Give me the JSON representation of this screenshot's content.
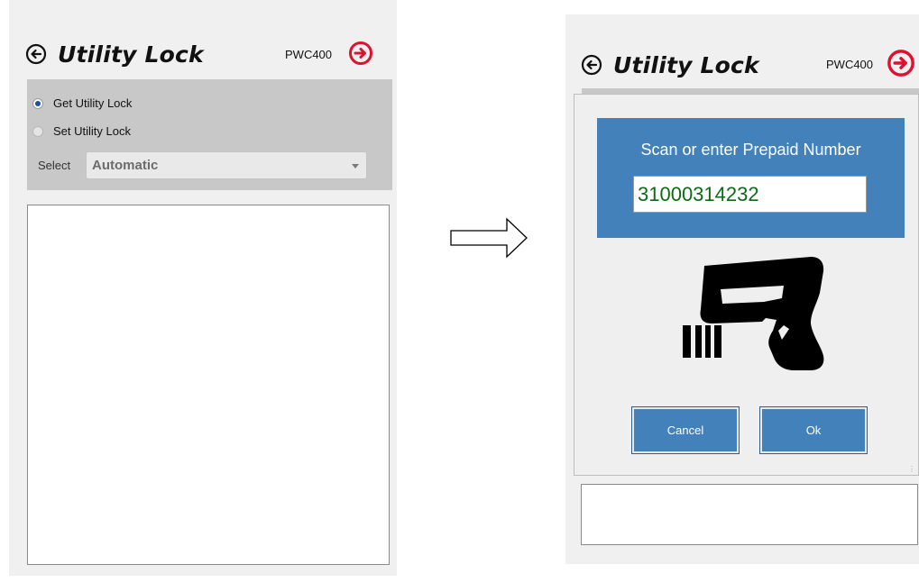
{
  "left_window": {
    "title": "Utility Lock",
    "model": "PWC400",
    "options": [
      {
        "label": "Get Utility Lock",
        "selected": true
      },
      {
        "label": "Set Utility Lock",
        "selected": false
      }
    ],
    "select_label": "Select",
    "select_value": "Automatic"
  },
  "right_window": {
    "title": "Utility Lock",
    "model": "PWC400",
    "dialog": {
      "prompt": "Scan or enter Prepaid Number",
      "input_value": "31000314232",
      "cancel_label": "Cancel",
      "ok_label": "Ok"
    }
  },
  "icons": [
    "back-arrow-icon",
    "forward-arrow-icon",
    "flow-arrow-icon",
    "barcode-scanner-icon",
    "resize-grip-icon"
  ],
  "colors": {
    "accent_blue": "#4281b9",
    "forward_icon_red": "#e0102f",
    "input_text_green": "#0c6b14",
    "options_bg": "#c8c8c8"
  }
}
